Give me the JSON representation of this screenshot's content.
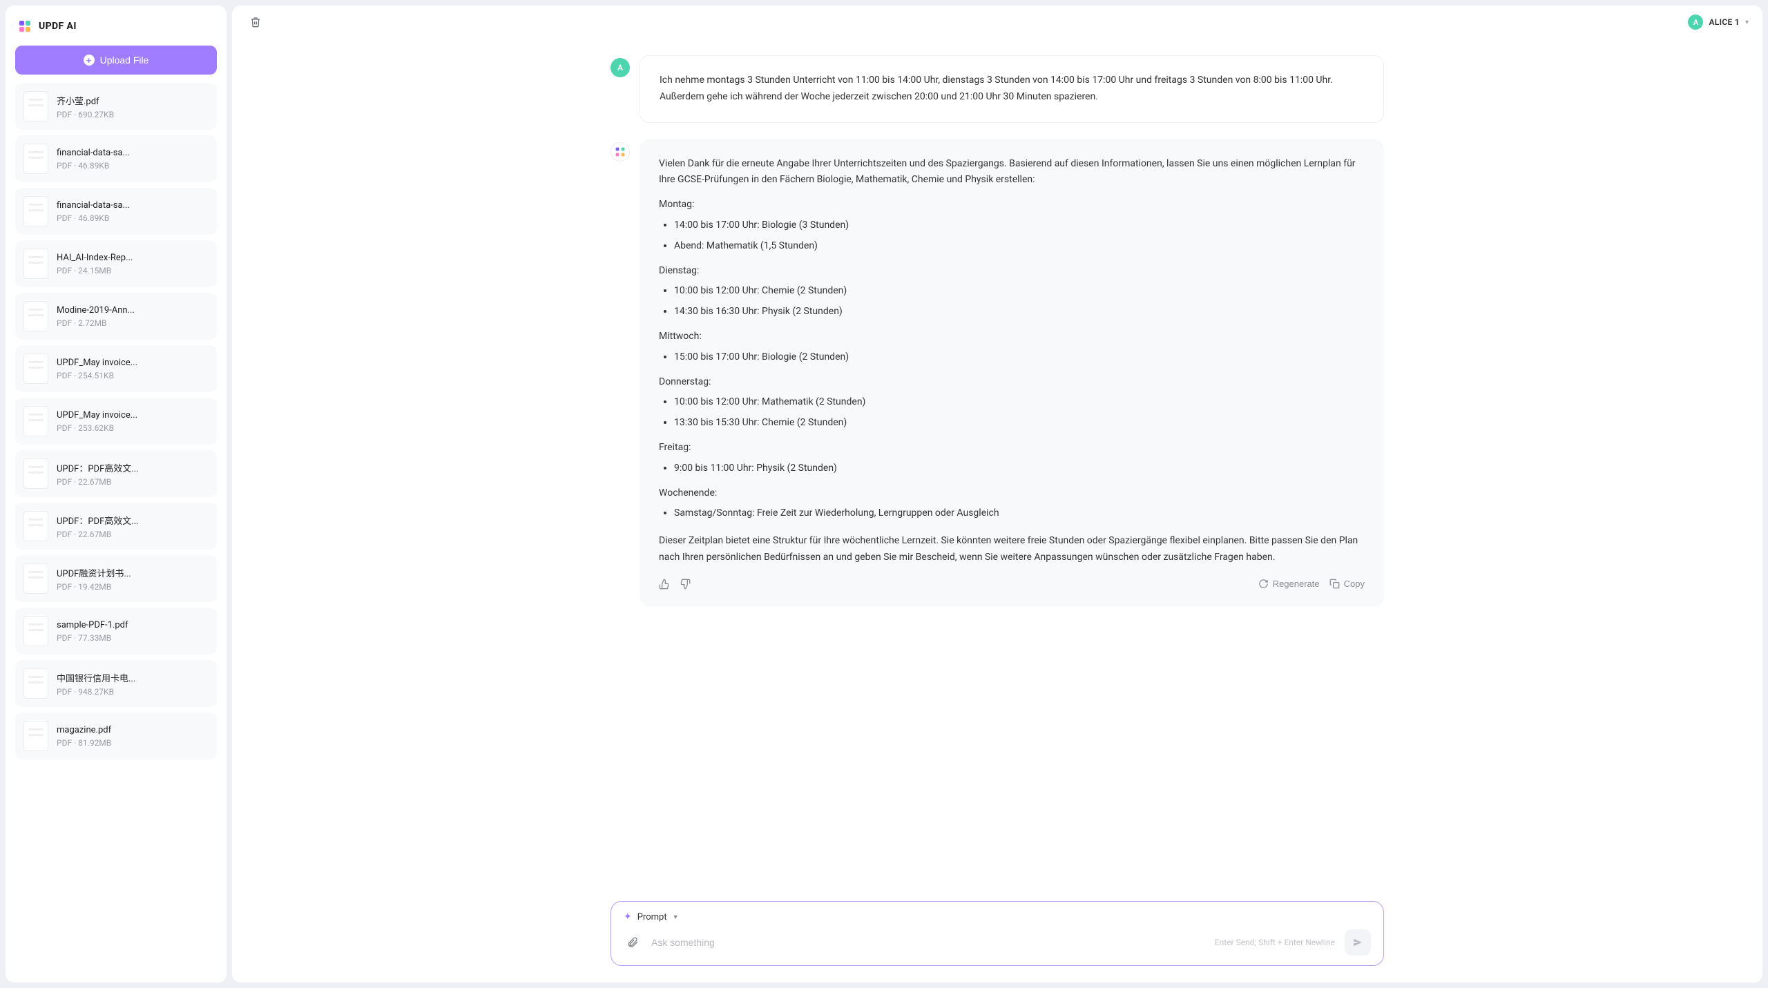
{
  "app": {
    "title": "UPDF AI"
  },
  "sidebar": {
    "upload_label": "Upload File",
    "files": [
      {
        "name": "齐小莹.pdf",
        "meta": "PDF · 690.27KB"
      },
      {
        "name": "financial-data-sa...",
        "meta": "PDF · 46.89KB"
      },
      {
        "name": "financial-data-sa...",
        "meta": "PDF · 46.89KB"
      },
      {
        "name": "HAI_AI-Index-Rep...",
        "meta": "PDF · 24.15MB"
      },
      {
        "name": "Modine-2019-Ann...",
        "meta": "PDF · 2.72MB"
      },
      {
        "name": "UPDF_May invoice...",
        "meta": "PDF · 254.51KB"
      },
      {
        "name": "UPDF_May invoice...",
        "meta": "PDF · 253.62KB"
      },
      {
        "name": "UPDF：PDF高效文...",
        "meta": "PDF · 22.67MB"
      },
      {
        "name": "UPDF：PDF高效文...",
        "meta": "PDF · 22.67MB"
      },
      {
        "name": "UPDF融资计划书...",
        "meta": "PDF · 19.42MB"
      },
      {
        "name": "sample-PDF-1.pdf",
        "meta": "PDF · 77.33MB"
      },
      {
        "name": "中国银行信用卡电...",
        "meta": "PDF · 948.27KB"
      },
      {
        "name": "magazine.pdf",
        "meta": "PDF · 81.92MB"
      }
    ]
  },
  "header": {
    "user_initial": "A",
    "user_name": "ALICE 1"
  },
  "chat": {
    "user_initial": "A",
    "user_msg": "Ich nehme montags 3 Stunden Unterricht von 11:00 bis 14:00 Uhr, dienstags 3 Stunden von 14:00 bis 17:00 Uhr und freitags 3 Stunden von 8:00 bis 11:00 Uhr. Außerdem gehe ich während der Woche jederzeit zwischen 20:00 und 21:00 Uhr 30 Minuten spazieren.",
    "ai_intro": "Vielen Dank für die erneute Angabe Ihrer Unterrichtszeiten und des Spaziergangs. Basierend auf diesen Informationen, lassen Sie uns einen möglichen Lernplan für Ihre GCSE-Prüfungen in den Fächern Biologie, Mathematik, Chemie und Physik erstellen:",
    "mon_h": "Montag:",
    "mon_1": "14:00 bis 17:00 Uhr: Biologie (3 Stunden)",
    "mon_2": "Abend: Mathematik (1,5 Stunden)",
    "tue_h": "Dienstag:",
    "tue_1": "10:00 bis 12:00 Uhr: Chemie (2 Stunden)",
    "tue_2": "14:30 bis 16:30 Uhr: Physik (2 Stunden)",
    "wed_h": "Mittwoch:",
    "wed_1": "15:00 bis 17:00 Uhr: Biologie (2 Stunden)",
    "thu_h": "Donnerstag:",
    "thu_1": "10:00 bis 12:00 Uhr: Mathematik (2 Stunden)",
    "thu_2": "13:30 bis 15:30 Uhr: Chemie (2 Stunden)",
    "fri_h": "Freitag:",
    "fri_1": "9:00 bis 11:00 Uhr: Physik (2 Stunden)",
    "wknd_h": "Wochenende:",
    "wknd_1": "Samstag/Sonntag: Freie Zeit zur Wiederholung, Lerngruppen oder Ausgleich",
    "ai_outro": "Dieser Zeitplan bietet eine Struktur für Ihre wöchentliche Lernzeit. Sie könnten weitere freie Stunden oder Spaziergänge flexibel einplanen. Bitte passen Sie den Plan nach Ihren persönlichen Bedürfnissen an und geben Sie mir Bescheid, wenn Sie weitere Anpassungen wünschen oder zusätzliche Fragen haben.",
    "regen": "Regenerate",
    "copy": "Copy"
  },
  "composer": {
    "prompt_label": "Prompt",
    "placeholder": "Ask something",
    "hint": "Enter Send; Shift + Enter Newline"
  }
}
